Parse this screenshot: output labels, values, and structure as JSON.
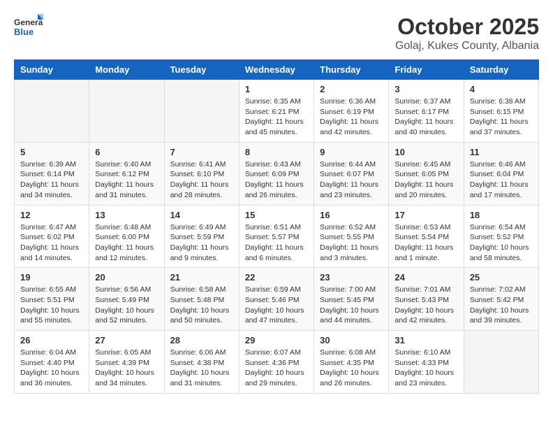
{
  "header": {
    "logo_general": "General",
    "logo_blue": "Blue",
    "month": "October 2025",
    "location": "Golaj, Kukes County, Albania"
  },
  "days_of_week": [
    "Sunday",
    "Monday",
    "Tuesday",
    "Wednesday",
    "Thursday",
    "Friday",
    "Saturday"
  ],
  "weeks": [
    [
      {
        "day": "",
        "info": ""
      },
      {
        "day": "",
        "info": ""
      },
      {
        "day": "",
        "info": ""
      },
      {
        "day": "1",
        "info": "Sunrise: 6:35 AM\nSunset: 6:21 PM\nDaylight: 11 hours\nand 45 minutes."
      },
      {
        "day": "2",
        "info": "Sunrise: 6:36 AM\nSunset: 6:19 PM\nDaylight: 11 hours\nand 42 minutes."
      },
      {
        "day": "3",
        "info": "Sunrise: 6:37 AM\nSunset: 6:17 PM\nDaylight: 11 hours\nand 40 minutes."
      },
      {
        "day": "4",
        "info": "Sunrise: 6:38 AM\nSunset: 6:15 PM\nDaylight: 11 hours\nand 37 minutes."
      }
    ],
    [
      {
        "day": "5",
        "info": "Sunrise: 6:39 AM\nSunset: 6:14 PM\nDaylight: 11 hours\nand 34 minutes."
      },
      {
        "day": "6",
        "info": "Sunrise: 6:40 AM\nSunset: 6:12 PM\nDaylight: 11 hours\nand 31 minutes."
      },
      {
        "day": "7",
        "info": "Sunrise: 6:41 AM\nSunset: 6:10 PM\nDaylight: 11 hours\nand 28 minutes."
      },
      {
        "day": "8",
        "info": "Sunrise: 6:43 AM\nSunset: 6:09 PM\nDaylight: 11 hours\nand 26 minutes."
      },
      {
        "day": "9",
        "info": "Sunrise: 6:44 AM\nSunset: 6:07 PM\nDaylight: 11 hours\nand 23 minutes."
      },
      {
        "day": "10",
        "info": "Sunrise: 6:45 AM\nSunset: 6:05 PM\nDaylight: 11 hours\nand 20 minutes."
      },
      {
        "day": "11",
        "info": "Sunrise: 6:46 AM\nSunset: 6:04 PM\nDaylight: 11 hours\nand 17 minutes."
      }
    ],
    [
      {
        "day": "12",
        "info": "Sunrise: 6:47 AM\nSunset: 6:02 PM\nDaylight: 11 hours\nand 14 minutes."
      },
      {
        "day": "13",
        "info": "Sunrise: 6:48 AM\nSunset: 6:00 PM\nDaylight: 11 hours\nand 12 minutes."
      },
      {
        "day": "14",
        "info": "Sunrise: 6:49 AM\nSunset: 5:59 PM\nDaylight: 11 hours\nand 9 minutes."
      },
      {
        "day": "15",
        "info": "Sunrise: 6:51 AM\nSunset: 5:57 PM\nDaylight: 11 hours\nand 6 minutes."
      },
      {
        "day": "16",
        "info": "Sunrise: 6:52 AM\nSunset: 5:55 PM\nDaylight: 11 hours\nand 3 minutes."
      },
      {
        "day": "17",
        "info": "Sunrise: 6:53 AM\nSunset: 5:54 PM\nDaylight: 11 hours\nand 1 minute."
      },
      {
        "day": "18",
        "info": "Sunrise: 6:54 AM\nSunset: 5:52 PM\nDaylight: 10 hours\nand 58 minutes."
      }
    ],
    [
      {
        "day": "19",
        "info": "Sunrise: 6:55 AM\nSunset: 5:51 PM\nDaylight: 10 hours\nand 55 minutes."
      },
      {
        "day": "20",
        "info": "Sunrise: 6:56 AM\nSunset: 5:49 PM\nDaylight: 10 hours\nand 52 minutes."
      },
      {
        "day": "21",
        "info": "Sunrise: 6:58 AM\nSunset: 5:48 PM\nDaylight: 10 hours\nand 50 minutes."
      },
      {
        "day": "22",
        "info": "Sunrise: 6:59 AM\nSunset: 5:46 PM\nDaylight: 10 hours\nand 47 minutes."
      },
      {
        "day": "23",
        "info": "Sunrise: 7:00 AM\nSunset: 5:45 PM\nDaylight: 10 hours\nand 44 minutes."
      },
      {
        "day": "24",
        "info": "Sunrise: 7:01 AM\nSunset: 5:43 PM\nDaylight: 10 hours\nand 42 minutes."
      },
      {
        "day": "25",
        "info": "Sunrise: 7:02 AM\nSunset: 5:42 PM\nDaylight: 10 hours\nand 39 minutes."
      }
    ],
    [
      {
        "day": "26",
        "info": "Sunrise: 6:04 AM\nSunset: 4:40 PM\nDaylight: 10 hours\nand 36 minutes."
      },
      {
        "day": "27",
        "info": "Sunrise: 6:05 AM\nSunset: 4:39 PM\nDaylight: 10 hours\nand 34 minutes."
      },
      {
        "day": "28",
        "info": "Sunrise: 6:06 AM\nSunset: 4:38 PM\nDaylight: 10 hours\nand 31 minutes."
      },
      {
        "day": "29",
        "info": "Sunrise: 6:07 AM\nSunset: 4:36 PM\nDaylight: 10 hours\nand 29 minutes."
      },
      {
        "day": "30",
        "info": "Sunrise: 6:08 AM\nSunset: 4:35 PM\nDaylight: 10 hours\nand 26 minutes."
      },
      {
        "day": "31",
        "info": "Sunrise: 6:10 AM\nSunset: 4:33 PM\nDaylight: 10 hours\nand 23 minutes."
      },
      {
        "day": "",
        "info": ""
      }
    ]
  ]
}
